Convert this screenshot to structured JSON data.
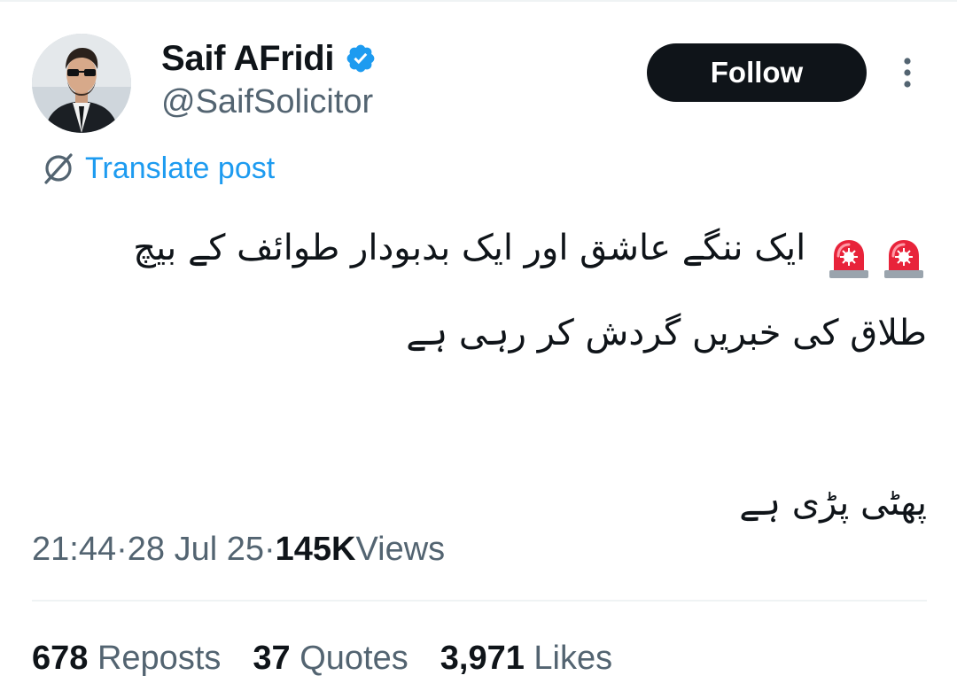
{
  "author": {
    "display_name": "Saif AFridi",
    "handle": "@SaifSolicitor",
    "verified": true,
    "avatar_icon": "profile-photo"
  },
  "actions": {
    "follow_label": "Follow",
    "more_icon": "vertical-ellipsis-icon"
  },
  "translate": {
    "label": "Translate post",
    "icon": "globe-icon"
  },
  "post": {
    "emoji": "siren-emoji",
    "lines": [
      "ایک ننگے عاشق اور ایک بدبودار طوائف کے بیچ",
      "طلاق کی خبریں گردش کر رہی ہے",
      "",
      "پھٹی پڑی ہے"
    ]
  },
  "meta": {
    "time": "21:44",
    "date": "28 Jul 25",
    "views_count": "145K",
    "views_label": "Views",
    "separator": "·"
  },
  "stats": {
    "reposts_count": "678",
    "reposts_label": "Reposts",
    "quotes_count": "37",
    "quotes_label": "Quotes",
    "likes_count": "3,971",
    "likes_label": "Likes"
  },
  "colors": {
    "accent": "#1d9bf0",
    "text_primary": "#0f1419",
    "text_secondary": "#536471",
    "follow_bg": "#0f1419",
    "divider": "#eff3f4"
  }
}
